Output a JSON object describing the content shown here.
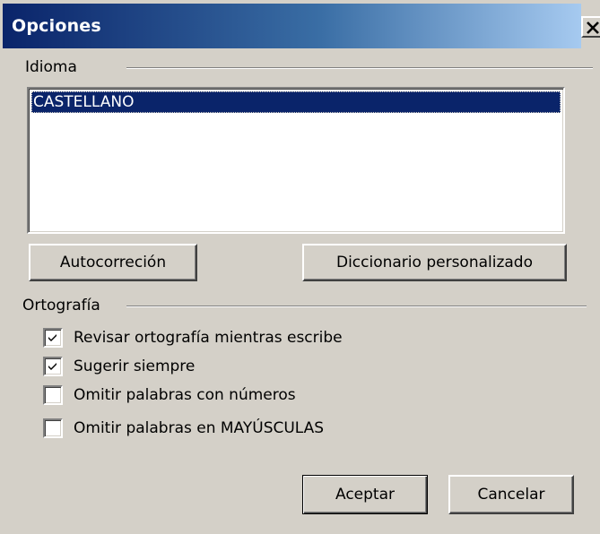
{
  "window": {
    "title": "Opciones",
    "close_icon": "close-icon"
  },
  "idioma": {
    "group_label": "Idioma",
    "languages": [
      "CASTELLANO"
    ],
    "selected": "CASTELLANO"
  },
  "buttons": {
    "autocorrection": "Autocorreción",
    "custom_dictionary": "Diccionario personalizado",
    "accept": "Aceptar",
    "cancel": "Cancelar"
  },
  "ortografia": {
    "group_label": "Ortografía",
    "options": [
      {
        "label": "Revisar ortografía mientras escribe",
        "checked": true
      },
      {
        "label": "Sugerir siempre",
        "checked": true
      },
      {
        "label": "Omitir palabras con números",
        "checked": false
      },
      {
        "label": "Omitir palabras en MAYÚSCULAS",
        "checked": false
      }
    ]
  },
  "colors": {
    "face": "#d4d0c8",
    "titlebar_start": "#0a246a",
    "titlebar_end": "#a6caf0",
    "selection": "#0a246a"
  }
}
